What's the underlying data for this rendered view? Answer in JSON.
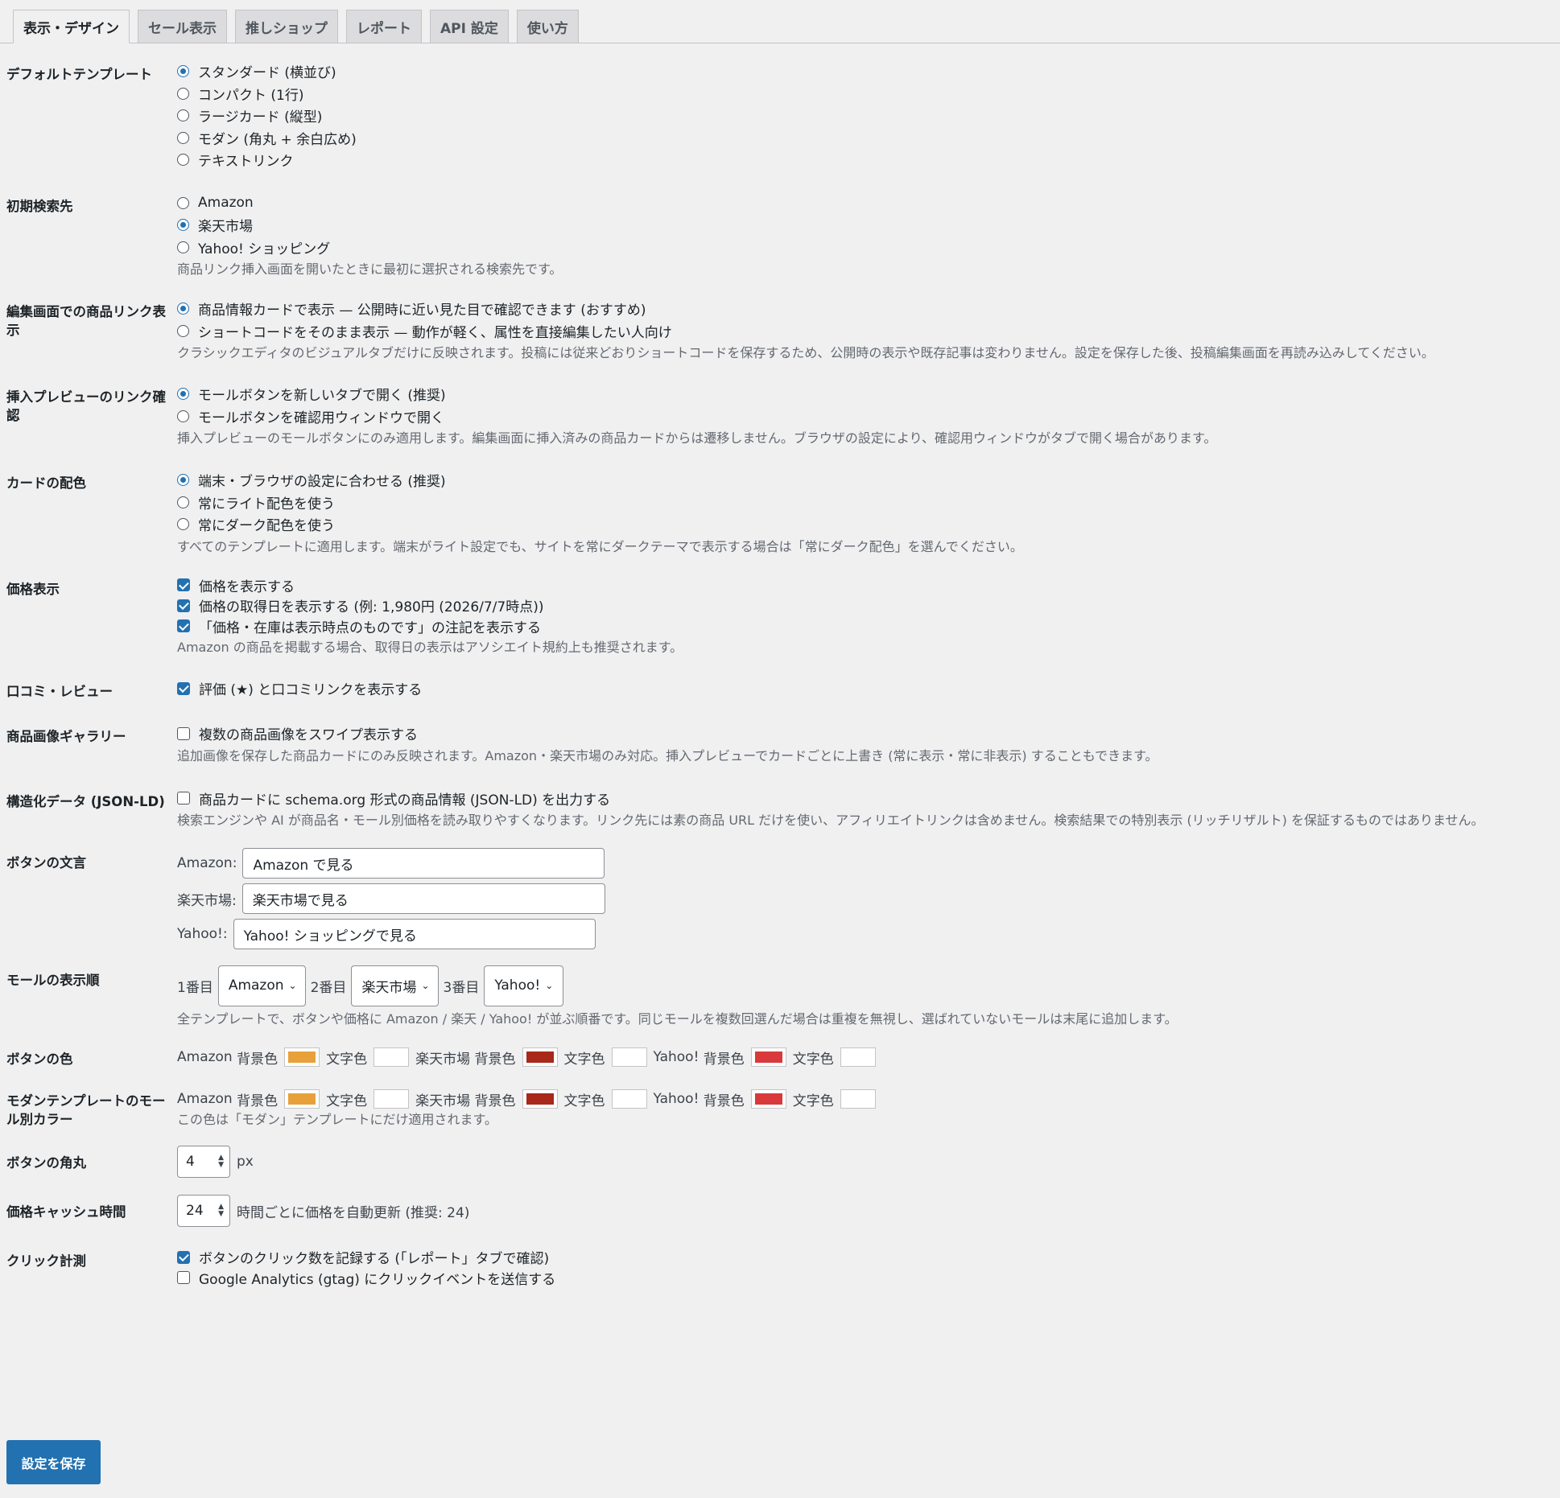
{
  "tabs": [
    "表示・デザイン",
    "セール表示",
    "推しショップ",
    "レポート",
    "API 設定",
    "使い方"
  ],
  "default_template": {
    "label": "デフォルトテンプレート",
    "options": [
      "スタンダード (横並び)",
      "コンパクト (1行)",
      "ラージカード (縦型)",
      "モダン (角丸 + 余白広め)",
      "テキストリンク"
    ]
  },
  "initial_search": {
    "label": "初期検索先",
    "options": [
      "Amazon",
      "楽天市場",
      "Yahoo! ショッピング"
    ],
    "desc": "商品リンク挿入画面を開いたときに最初に選択される検索先です。"
  },
  "editor_display": {
    "label": "編集画面での商品リンク表示",
    "options": [
      "商品情報カードで表示 — 公開時に近い見た目で確認できます (おすすめ)",
      "ショートコードをそのまま表示 — 動作が軽く、属性を直接編集したい人向け"
    ],
    "desc": "クラシックエディタのビジュアルタブだけに反映されます。投稿には従来どおりショートコードを保存するため、公開時の表示や既存記事は変わりません。設定を保存した後、投稿編集画面を再読み込みしてください。"
  },
  "preview_link": {
    "label": "挿入プレビューのリンク確認",
    "options": [
      "モールボタンを新しいタブで開く (推奨)",
      "モールボタンを確認用ウィンドウで開く"
    ],
    "desc": "挿入プレビューのモールボタンにのみ適用します。編集画面に挿入済みの商品カードからは遷移しません。ブラウザの設定により、確認用ウィンドウがタブで開く場合があります。"
  },
  "card_color": {
    "label": "カードの配色",
    "options": [
      "端末・ブラウザの設定に合わせる (推奨)",
      "常にライト配色を使う",
      "常にダーク配色を使う"
    ],
    "desc": "すべてのテンプレートに適用します。端末がライト設定でも、サイトを常にダークテーマで表示する場合は「常にダーク配色」を選んでください。"
  },
  "price": {
    "label": "価格表示",
    "options": [
      "価格を表示する",
      "価格の取得日を表示する (例: 1,980円 (2026/7/7時点))",
      "「価格・在庫は表示時点のものです」の注記を表示する"
    ],
    "desc": "Amazon の商品を掲載する場合、取得日の表示はアソシエイト規約上も推奨されます。"
  },
  "review": {
    "label": "口コミ・レビュー",
    "option": "評価 (★) と口コミリンクを表示する"
  },
  "gallery": {
    "label": "商品画像ギャラリー",
    "option": "複数の商品画像をスワイプ表示する",
    "desc": "追加画像を保存した商品カードにのみ反映されます。Amazon・楽天市場のみ対応。挿入プレビューでカードごとに上書き (常に表示・常に非表示) することもできます。"
  },
  "structured": {
    "label": "構造化データ (JSON-LD)",
    "option": "商品カードに schema.org 形式の商品情報 (JSON-LD) を出力する",
    "desc": "検索エンジンや AI が商品名・モール別価格を読み取りやすくなります。リンク先には素の商品 URL だけを使い、アフィリエイトリンクは含めません。検索結果での特別表示 (リッチリザルト) を保証するものではありません。"
  },
  "button_text": {
    "label": "ボタンの文言",
    "fields": [
      {
        "label": "Amazon:",
        "value": "Amazon で見る"
      },
      {
        "label": "楽天市場:",
        "value": "楽天市場で見る"
      },
      {
        "label": "Yahoo!:",
        "value": "Yahoo! ショッピングで見る"
      }
    ]
  },
  "mall_order": {
    "label": "モールの表示順",
    "slots": [
      {
        "label": "1番目",
        "value": "Amazon"
      },
      {
        "label": "2番目",
        "value": "楽天市場"
      },
      {
        "label": "3番目",
        "value": "Yahoo!"
      }
    ],
    "desc": "全テンプレートで、ボタンや価格に Amazon / 楽天 / Yahoo! が並ぶ順番です。同じモールを複数回選んだ場合は重複を無視し、選ばれていないモールは末尾に追加します。"
  },
  "button_color": {
    "label": "ボタンの色",
    "malls": [
      {
        "name": "Amazon",
        "bg_label": "背景色",
        "bg": "#e8a13a",
        "fg_label": "文字色",
        "fg": "#ffffff"
      },
      {
        "name": "楽天市場",
        "bg_label": "背景色",
        "bg": "#a8281a",
        "fg_label": "文字色",
        "fg": "#ffffff"
      },
      {
        "name": "Yahoo!",
        "bg_label": "背景色",
        "bg": "#d9393a",
        "fg_label": "文字色",
        "fg": "#ffffff"
      }
    ]
  },
  "modern_color": {
    "label": "モダンテンプレートのモール別カラー",
    "malls": [
      {
        "name": "Amazon",
        "bg_label": "背景色",
        "bg": "#e8a13a",
        "fg_label": "文字色",
        "fg": "#ffffff"
      },
      {
        "name": "楽天市場",
        "bg_label": "背景色",
        "bg": "#a8281a",
        "fg_label": "文字色",
        "fg": "#ffffff"
      },
      {
        "name": "Yahoo!",
        "bg_label": "背景色",
        "bg": "#d9393a",
        "fg_label": "文字色",
        "fg": "#ffffff"
      }
    ],
    "desc": "この色は「モダン」テンプレートにだけ適用されます。"
  },
  "radius": {
    "label": "ボタンの角丸",
    "value": "4",
    "unit": "px"
  },
  "cache": {
    "label": "価格キャッシュ時間",
    "value": "24",
    "unit": "時間ごとに価格を自動更新 (推奨: 24)"
  },
  "click": {
    "label": "クリック計測",
    "options": [
      "ボタンのクリック数を記録する (「レポート」タブで確認)",
      "Google Analytics (gtag) にクリックイベントを送信する"
    ]
  },
  "save_label": "設定を保存",
  "accent_color": "#2271b1"
}
